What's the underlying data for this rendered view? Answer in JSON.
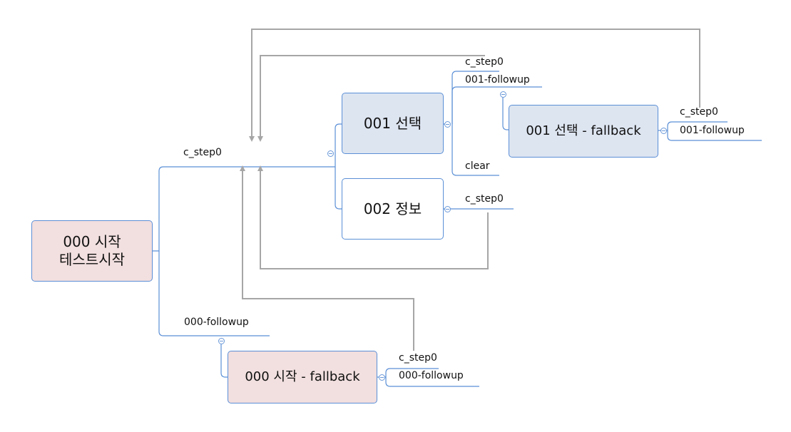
{
  "diagram": {
    "colors": {
      "connector": "#5b8fd6",
      "jump_arrow": "#a6a6a6",
      "node_start": "#f2dfdf",
      "node_select": "#dde5f1",
      "node_info": "#ffffff"
    },
    "nodes": {
      "root": {
        "line1": "000 시작",
        "line2": "테스트시작"
      },
      "select": {
        "label": "001 선택"
      },
      "info": {
        "label": "002 정보"
      },
      "select_fallback": {
        "label": "001 선택 - fallback"
      },
      "start_fallback": {
        "label": "000 시작 - fallback"
      }
    },
    "edges": {
      "root_c_step0": "c_step0",
      "root_followup": "000-followup",
      "select_c_step0": "c_step0",
      "select_followup": "001-followup",
      "select_clear": "clear",
      "info_c_step0": "c_step0",
      "select_fb_c_step0": "c_step0",
      "select_fb_followup": "001-followup",
      "start_fb_c_step0": "c_step0",
      "start_fb_followup": "000-followup"
    }
  }
}
